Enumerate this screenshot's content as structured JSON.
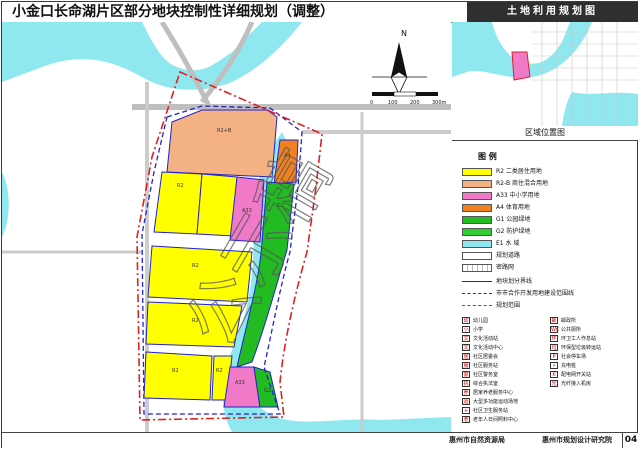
{
  "title": "小金口长命湖片区部分地块控制性详细规划（调整）",
  "sheet_title": "土地利用规划图",
  "locator_caption": "区域位置图",
  "footer": {
    "org_a": "惠州市自然资源局",
    "org_b": "惠州市规划设计研究院",
    "sheet_number": "04"
  },
  "watermark": "公示稿",
  "scale_bar": {
    "ticks": [
      "0",
      "100",
      "200",
      "300m"
    ]
  },
  "north_label": "N",
  "legend": {
    "title": "图 例",
    "items": [
      {
        "label": "R2  二类居住用地",
        "color": "#ffff00"
      },
      {
        "label": "R2-B  商住混合用地",
        "color": "#f4b183"
      },
      {
        "label": "A33  中小学用地",
        "color": "#f07ac8"
      },
      {
        "label": "A4  体育用地",
        "color": "#f08020"
      },
      {
        "label": "G1  公园绿地",
        "color": "#22bb22"
      },
      {
        "label": "G2  防护绿地",
        "color": "#33cc33"
      },
      {
        "label": "E1  水  域",
        "color": "#8fe8f0"
      },
      {
        "label": "规划道路",
        "color": "#ffffff"
      },
      {
        "label": "密路网",
        "color": "#ffffff"
      }
    ],
    "lines": [
      {
        "label": "地块划分界线",
        "color": "#2222cc",
        "style": "solid"
      },
      {
        "label": "市市合作开发用地建设范围线",
        "color": "#2222cc",
        "style": "dashed"
      },
      {
        "label": "规划范围",
        "color": "#dd2222",
        "style": "dashdot"
      }
    ],
    "symbols_left": [
      "幼儿园",
      "小学",
      "文化活动站",
      "文化活动中心",
      "社区居委会",
      "社区服务站",
      "社区警务室",
      "综合执法室",
      "居家养老服务中心",
      "大型多功能运动场地",
      "社区卫生服务站",
      "老年人日间照料中心"
    ],
    "symbols_right": [
      "邮政所",
      "公共厕所",
      "环卫工人作息站",
      "环保型垃圾转运站",
      "社会停车场",
      "充电桩",
      "配电网开关站",
      "光纤接入机房"
    ]
  },
  "parcels": [
    "R2+B",
    "A4",
    "R2",
    "A33",
    "G1",
    "R2",
    "R2",
    "G2",
    "R2",
    "R2",
    "A33"
  ],
  "colors": {
    "residential": "#ffff00",
    "commercial": "#f4b183",
    "school": "#f07ac8",
    "sports": "#f08020",
    "green": "#22bb22",
    "water": "#8fe8f0",
    "boundary": "#dd2222",
    "parcel_line": "#2222cc"
  }
}
